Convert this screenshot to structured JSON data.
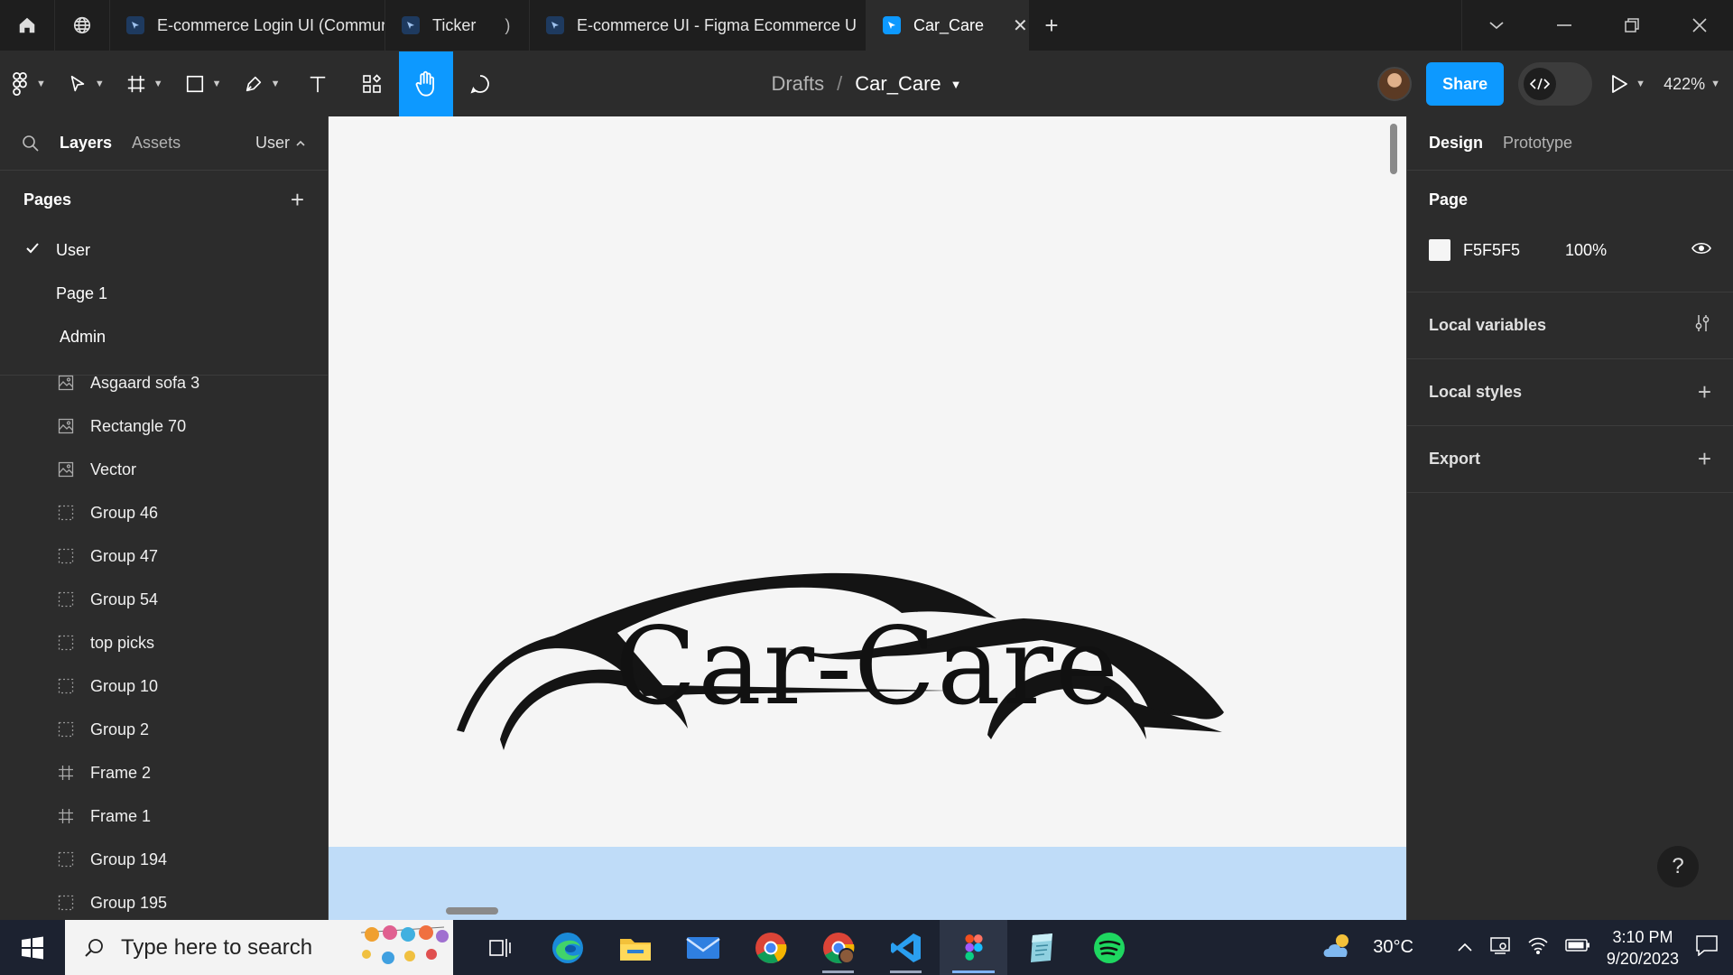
{
  "tabs": [
    {
      "label": "E-commerce Login UI (Community)",
      "active": false
    },
    {
      "label": "Ticker",
      "active": false
    },
    {
      "label": "E-commerce UI - Figma Ecommerce U",
      "active": false
    },
    {
      "label": "Car_Care",
      "active": true
    }
  ],
  "toolbar": {
    "breadcrumb_root": "Drafts",
    "breadcrumb_sep": "/",
    "file_name": "Car_Care",
    "share_label": "Share",
    "zoom": "422%"
  },
  "left_panel": {
    "tab_layers": "Layers",
    "tab_assets": "Assets",
    "current_page": "User",
    "pages_title": "Pages",
    "pages": [
      {
        "label": "User",
        "current": true
      },
      {
        "label": "Page 1",
        "current": false
      },
      {
        "label": "Admin",
        "current": false
      }
    ],
    "layers": [
      {
        "label": "Asgaard sofa 3",
        "icon": "image-icon"
      },
      {
        "label": "Rectangle 70",
        "icon": "image-icon"
      },
      {
        "label": "Vector",
        "icon": "image-icon"
      },
      {
        "label": "Group 46",
        "icon": "group-icon"
      },
      {
        "label": "Group 47",
        "icon": "group-icon"
      },
      {
        "label": "Group 54",
        "icon": "group-icon"
      },
      {
        "label": "top picks",
        "icon": "group-icon"
      },
      {
        "label": "Group 10",
        "icon": "group-icon"
      },
      {
        "label": "Group 2",
        "icon": "group-icon"
      },
      {
        "label": "Frame 2",
        "icon": "frame-icon"
      },
      {
        "label": "Frame 1",
        "icon": "frame-icon"
      },
      {
        "label": "Group 194",
        "icon": "group-icon"
      },
      {
        "label": "Group 195",
        "icon": "group-icon"
      }
    ]
  },
  "canvas": {
    "brand_text": "Car-Care",
    "background": "#F5F5F5",
    "band_color": "#BFDCF8"
  },
  "right_panel": {
    "tab_design": "Design",
    "tab_prototype": "Prototype",
    "page_title": "Page",
    "page_color": "F5F5F5",
    "page_opacity": "100%",
    "local_variables": "Local variables",
    "local_styles": "Local styles",
    "export": "Export",
    "help": "?"
  },
  "taskbar": {
    "search_placeholder": "Type here to search",
    "weather": "30°C",
    "time": "3:10 PM",
    "date": "9/20/2023"
  },
  "colors": {
    "accent": "#0D99FF",
    "panel": "#2C2C2C",
    "chrome": "#1E1E1E"
  }
}
